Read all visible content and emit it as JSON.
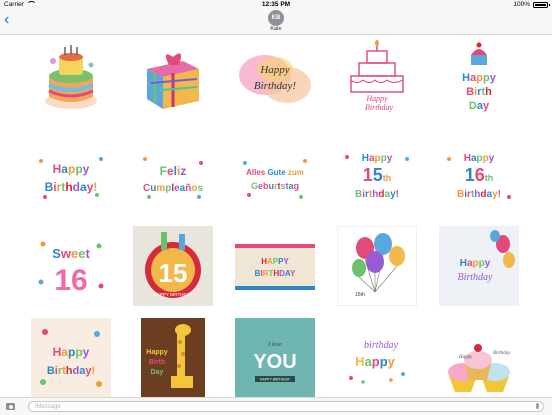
{
  "status_bar": {
    "carrier": "Carrier",
    "time": "12:35 PM",
    "battery_text": "100%",
    "battery_level": 1.0
  },
  "conversation": {
    "back_glyph": "‹",
    "contact_initials": "KB",
    "contact_name": "Kate"
  },
  "stickers": [
    {
      "label": "rainbow cake sticker"
    },
    {
      "label": "gift box sticker"
    },
    {
      "label": "Happy Birthday watercolor sticker",
      "text": "Happy Birthday!"
    },
    {
      "label": "pink birthday cake sticker",
      "text": "Happy Birthday"
    },
    {
      "label": "cupcake Happy Birth Day sticker",
      "text": "Happy Birth Day"
    },
    {
      "label": "Happy Birthday letters sticker",
      "text": "Happy Birthday!"
    },
    {
      "label": "Feliz Cumpleaños sticker",
      "text": "Feliz Cumpleaños"
    },
    {
      "label": "Alles Gute zum Geburtstag sticker",
      "text": "Alles Gute zum Geburtstag"
    },
    {
      "label": "Happy 15th Birthday sticker",
      "text": "Happy 15th Birthday!"
    },
    {
      "label": "Happy 16th Birthday sticker",
      "text": "Happy 16th Birthday!"
    },
    {
      "label": "Sweet 16 sticker",
      "text": "Sweet 16"
    },
    {
      "label": "15 happy birthday sticker",
      "text": "15"
    },
    {
      "label": "Happy Birthday banner sticker",
      "text": "HAPPY BIRTHDAY"
    },
    {
      "label": "15th birthday balloons sticker",
      "text": "15"
    },
    {
      "label": "Happy Birthday balloons sticker",
      "text": "Happy Birthday"
    },
    {
      "label": "Happy Birthday colorful sticker",
      "text": "Happy Birthday!"
    },
    {
      "label": "giraffe Happy Birth Day sticker",
      "text": "Happy Birth Day"
    },
    {
      "label": "I love YOU sticker",
      "text": "YOU"
    },
    {
      "label": "birthday happy lettering sticker",
      "text": "birthday happy"
    },
    {
      "label": "cupcakes sticker",
      "text": "Happy Birthday"
    }
  ],
  "input_bar": {
    "placeholder": "iMessage"
  },
  "colors": {
    "accent": "#0a7aff",
    "avatar": "#8e939b",
    "bar": "#f7f7f7"
  },
  "icons": {
    "back": "chevron-left-icon",
    "camera": "camera-icon",
    "mic": "mic-icon",
    "wifi": "wifi-icon",
    "battery": "battery-icon"
  }
}
